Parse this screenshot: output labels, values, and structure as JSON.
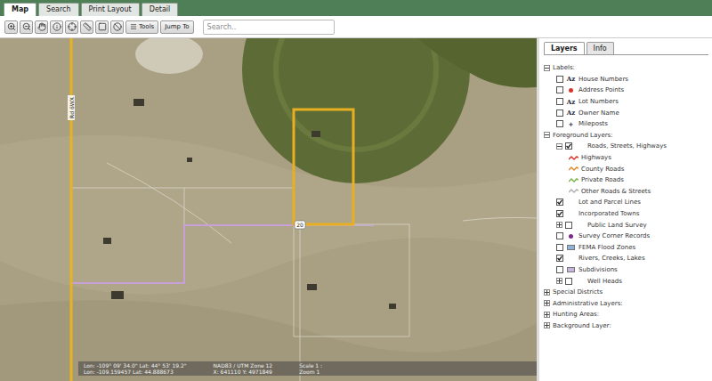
{
  "tabs": [
    {
      "label": "Map",
      "selected": true
    },
    {
      "label": "Search",
      "selected": false
    },
    {
      "label": "Print Layout",
      "selected": false
    },
    {
      "label": "Detail",
      "selected": false
    }
  ],
  "toolbar": {
    "buttons": [
      "Tools",
      "Jump To"
    ]
  },
  "search": {
    "placeholder": "Search.."
  },
  "map": {
    "road_labels": [
      {
        "text": "Rd 6WX",
        "kind": "vertical"
      },
      {
        "text": "20",
        "kind": "shield"
      }
    ],
    "status_bar": {
      "columns": [
        [
          "Lon: -109° 09' 34.0\" Lat: 44° 53' 19.2\"",
          "Lon: -109.159457 Lat: 44.888673"
        ],
        [
          "NAD83 / UTM Zone 12",
          "X: 641110 Y: 4971849"
        ],
        [
          "Scale 1 :",
          "Zoom 1"
        ]
      ]
    }
  },
  "layers_panel": {
    "tabs": [
      {
        "label": "Layers",
        "selected": true
      },
      {
        "label": "Info",
        "selected": false
      }
    ],
    "tree": [
      {
        "label": "Labels:",
        "kind": "group",
        "expanded": true,
        "children": [
          {
            "label": "House Numbers",
            "kind": "layer",
            "checked": false,
            "symbol": {
              "kind": "text",
              "text": "Az"
            }
          },
          {
            "label": "Address Points",
            "kind": "layer",
            "checked": false,
            "symbol": {
              "kind": "dot",
              "color": "#d9342b"
            }
          },
          {
            "label": "Lot Numbers",
            "kind": "layer",
            "checked": false,
            "symbol": {
              "kind": "text",
              "text": "Az"
            }
          },
          {
            "label": "Owner Name",
            "kind": "layer",
            "checked": false,
            "symbol": {
              "kind": "text",
              "text": "Az"
            }
          },
          {
            "label": "Mileposts",
            "kind": "layer",
            "checked": false,
            "symbol": {
              "kind": "text",
              "text": "+"
            }
          }
        ]
      },
      {
        "label": "Foreground Layers:",
        "kind": "group",
        "expanded": true,
        "children": [
          {
            "label": "Roads, Streets, Highways",
            "kind": "layer",
            "expanded": true,
            "checked": true,
            "children": [
              {
                "label": "Highways",
                "kind": "legend",
                "symbol": {
                  "kind": "line",
                  "color": "#d9342b"
                }
              },
              {
                "label": "County Roads",
                "kind": "legend",
                "symbol": {
                  "kind": "line",
                  "color": "#e08a2c"
                }
              },
              {
                "label": "Private Roads",
                "kind": "legend",
                "symbol": {
                  "kind": "line",
                  "color": "#7ab648"
                }
              },
              {
                "label": "Other Roads & Streets",
                "kind": "legend",
                "symbol": {
                  "kind": "line",
                  "color": "#b0b0b0"
                }
              }
            ]
          },
          {
            "label": "Lot and Parcel Lines",
            "kind": "layer",
            "checked": true
          },
          {
            "label": "Incorporated Towns",
            "kind": "layer",
            "checked": true
          },
          {
            "label": "Public Land Survey",
            "kind": "layer",
            "expanded": false,
            "checked": false,
            "children": []
          },
          {
            "label": "Survey Corner Records",
            "kind": "layer",
            "checked": false,
            "symbol": {
              "kind": "dot",
              "color": "#7b2a8c"
            }
          },
          {
            "label": "FEMA Flood Zones",
            "kind": "layer",
            "checked": false,
            "symbol": {
              "kind": "box",
              "color": "#8fb3d9"
            }
          },
          {
            "label": "Rivers, Creeks, Lakes",
            "kind": "layer",
            "checked": true
          },
          {
            "label": "Subdivisions",
            "kind": "layer",
            "checked": false,
            "symbol": {
              "kind": "box",
              "color": "#c9b3e0"
            }
          },
          {
            "label": "Well Heads",
            "kind": "layer",
            "expanded": false,
            "checked": false,
            "children": []
          }
        ]
      },
      {
        "label": "Special Districts",
        "kind": "group",
        "expanded": false,
        "children": []
      },
      {
        "label": "Administrative Layers:",
        "kind": "group",
        "expanded": false,
        "children": []
      },
      {
        "label": "Hunting Areas:",
        "kind": "group",
        "expanded": false,
        "children": []
      },
      {
        "label": "Background Layer:",
        "kind": "group",
        "expanded": false,
        "children": []
      }
    ]
  }
}
